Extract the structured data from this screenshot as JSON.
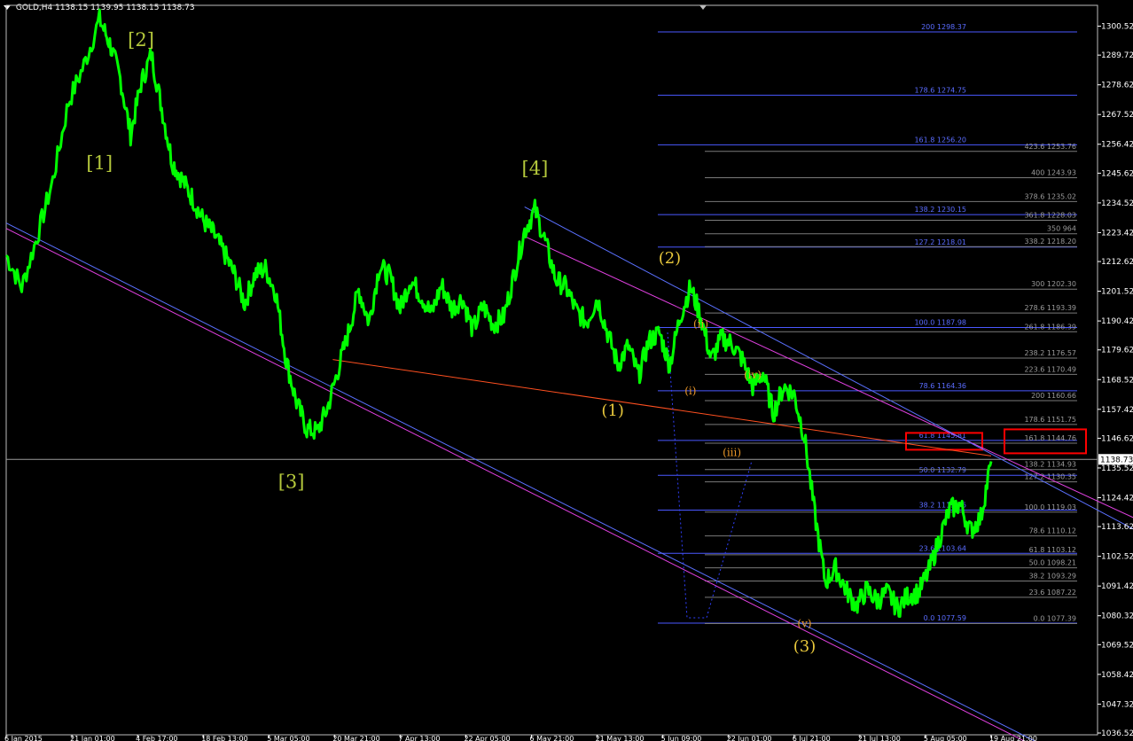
{
  "header": {
    "symbol": "GOLD,H4",
    "ohlc": "1138.15 1139.95 1138.15 1138.73"
  },
  "colors": {
    "background": "#000000",
    "price": "#00ff00",
    "axis": "#ffffff",
    "wave_major": "#b4c83c",
    "wave_intermediate": "#e8c83c",
    "wave_minor": "#e89628",
    "fib_line": "#4a58ff",
    "fib_line_right": "#7a7a7a",
    "fib_text": "#5a6cff",
    "fib_text_right": "#9a9a9a",
    "channel_magenta": "#e040e0",
    "channel_blue": "#5a70ff",
    "trend_orange": "#ff5020",
    "highlight_box": "#ff0000"
  },
  "chart_data": {
    "type": "line",
    "series_name": "GOLD,H4",
    "ylim": [
      1036.52,
      1305.0
    ],
    "y_ticks": [
      "1300.52",
      "1289.72",
      "1278.62",
      "1267.52",
      "1256.42",
      "1245.62",
      "1234.52",
      "1223.42",
      "1212.62",
      "1201.52",
      "1190.42",
      "1179.62",
      "1168.52",
      "1157.42",
      "1146.62",
      "1135.52",
      "1124.42",
      "1113.62",
      "1102.52",
      "1091.42",
      "1080.32",
      "1069.52",
      "1058.42",
      "1047.32",
      "1036.52"
    ],
    "current_price": "1138.73",
    "x_ticks": [
      "6 Jan 2015",
      "21 Jan 01:00",
      "4 Feb 17:00",
      "18 Feb 13:00",
      "5 Mar 05:00",
      "20 Mar 21:00",
      "7 Apr 13:00",
      "22 Apr 05:00",
      "6 May 21:00",
      "21 May 13:00",
      "5 Jun 09:00",
      "22 Jun 01:00",
      "6 Jul 21:00",
      "21 Jul 13:00",
      "5 Aug 05:00",
      "19 Aug 21:00"
    ],
    "price_points": [
      [
        0,
        1215
      ],
      [
        3,
        1203
      ],
      [
        6,
        1222
      ],
      [
        9,
        1243
      ],
      [
        12,
        1272
      ],
      [
        15,
        1286
      ],
      [
        18,
        1303
      ],
      [
        20,
        1294
      ],
      [
        22,
        1281
      ],
      [
        24,
        1260
      ],
      [
        26,
        1279
      ],
      [
        28,
        1290
      ],
      [
        30,
        1270
      ],
      [
        32,
        1250
      ],
      [
        34,
        1243
      ],
      [
        36,
        1236
      ],
      [
        38,
        1228
      ],
      [
        40,
        1223
      ],
      [
        42,
        1216
      ],
      [
        44,
        1208
      ],
      [
        46,
        1197
      ],
      [
        48,
        1208
      ],
      [
        50,
        1210
      ],
      [
        52,
        1201
      ],
      [
        54,
        1176
      ],
      [
        56,
        1160
      ],
      [
        58,
        1150
      ],
      [
        60,
        1149
      ],
      [
        62,
        1158
      ],
      [
        64,
        1172
      ],
      [
        66,
        1186
      ],
      [
        68,
        1202
      ],
      [
        70,
        1190
      ],
      [
        72,
        1211
      ],
      [
        74,
        1207
      ],
      [
        76,
        1195
      ],
      [
        78,
        1206
      ],
      [
        80,
        1200
      ],
      [
        82,
        1193
      ],
      [
        84,
        1204
      ],
      [
        86,
        1195
      ],
      [
        88,
        1199
      ],
      [
        90,
        1187
      ],
      [
        92,
        1196
      ],
      [
        94,
        1189
      ],
      [
        96,
        1192
      ],
      [
        98,
        1208
      ],
      [
        100,
        1224
      ],
      [
        102,
        1232
      ],
      [
        104,
        1220
      ],
      [
        106,
        1206
      ],
      [
        108,
        1203
      ],
      [
        110,
        1194
      ],
      [
        112,
        1190
      ],
      [
        114,
        1199
      ],
      [
        116,
        1186
      ],
      [
        118,
        1174
      ],
      [
        120,
        1181
      ],
      [
        122,
        1170
      ],
      [
        124,
        1183
      ],
      [
        126,
        1186
      ],
      [
        128,
        1174
      ],
      [
        130,
        1192
      ],
      [
        132,
        1203
      ],
      [
        134,
        1192
      ],
      [
        136,
        1176
      ],
      [
        138,
        1184
      ],
      [
        140,
        1182
      ],
      [
        142,
        1176
      ],
      [
        144,
        1166
      ],
      [
        146,
        1171
      ],
      [
        148,
        1156
      ],
      [
        150,
        1166
      ],
      [
        152,
        1163
      ],
      [
        154,
        1147
      ],
      [
        156,
        1118
      ],
      [
        158,
        1093
      ],
      [
        160,
        1098
      ],
      [
        162,
        1090
      ],
      [
        164,
        1084
      ],
      [
        166,
        1090
      ],
      [
        168,
        1086
      ],
      [
        170,
        1089
      ],
      [
        172,
        1083
      ],
      [
        174,
        1088
      ],
      [
        176,
        1089
      ],
      [
        178,
        1097
      ],
      [
        180,
        1109
      ],
      [
        182,
        1120
      ],
      [
        184,
        1122
      ],
      [
        186,
        1112
      ],
      [
        188,
        1117
      ],
      [
        190,
        1138
      ]
    ],
    "wave_labels": [
      {
        "text": "[1]",
        "x": 18,
        "y": 1247,
        "level": "major"
      },
      {
        "text": "[2]",
        "x": 26,
        "y": 1293,
        "level": "major"
      },
      {
        "text": "[3]",
        "x": 55,
        "y": 1128,
        "level": "major"
      },
      {
        "text": "[4]",
        "x": 102,
        "y": 1245,
        "level": "major"
      },
      {
        "text": "(1)",
        "x": 117,
        "y": 1155,
        "level": "intermediate"
      },
      {
        "text": "(2)",
        "x": 128,
        "y": 1212,
        "level": "intermediate"
      },
      {
        "text": "(3)",
        "x": 154,
        "y": 1067,
        "level": "intermediate"
      },
      {
        "text": "(i)",
        "x": 132,
        "y": 1163,
        "level": "minor"
      },
      {
        "text": "(ii)",
        "x": 134,
        "y": 1188,
        "level": "minor"
      },
      {
        "text": "(iii)",
        "x": 140,
        "y": 1140,
        "level": "minor"
      },
      {
        "text": "(iv)",
        "x": 144,
        "y": 1169,
        "level": "minor"
      },
      {
        "text": "(v)",
        "x": 154,
        "y": 1076,
        "level": "minor"
      }
    ],
    "fib_left": [
      "200 1298.37",
      "178.6 1274.75",
      "161.8 1256.20",
      "138.2 1230.15",
      "127.2 1218.01",
      "100.0 1187.98",
      "78.6 1164.36",
      "61.8 1145.81",
      "50.0 1132.79",
      "38.2 1119.76",
      "23.6 1103.64",
      "0.0 1077.59"
    ],
    "fib_left_levels": [
      1298.37,
      1274.75,
      1256.2,
      1230.15,
      1218.01,
      1187.98,
      1164.36,
      1145.81,
      1132.79,
      1119.76,
      1103.64,
      1077.59
    ],
    "fib_right": [
      "423.6 1253.76",
      "400 1243.93",
      "378.6 1235.02",
      "361.8 1228.03",
      "350 964",
      "338.2 1218.20",
      "300 1202.30",
      "278.6 1193.39",
      "261.8 1186.39",
      "238.2 1176.57",
      "223.6 1170.49",
      "200 1160.66",
      "178.6 1151.75",
      "161.8 1144.76",
      "138.2 1134.93",
      "127.2 1130.35",
      "100.0 1119.03",
      "78.6 1110.12",
      "61.8 1103.12",
      "50.0 1098.21",
      "38.2 1093.29",
      "23.6 1087.22",
      "0.0 1077.39"
    ],
    "fib_right_levels": [
      1253.76,
      1243.93,
      1235.02,
      1228.03,
      1223.0,
      1218.2,
      1202.3,
      1193.39,
      1186.39,
      1176.57,
      1170.49,
      1160.66,
      1151.75,
      1144.76,
      1134.93,
      1130.35,
      1119.03,
      1110.12,
      1103.12,
      1098.21,
      1093.29,
      1087.22,
      1077.39
    ],
    "highlighted": [
      "61.8 1145.81",
      "161.8 1144.76"
    ],
    "trendlines": [
      {
        "color": "magenta",
        "p1": [
          0,
          1225
        ],
        "p2": [
          200,
          1030
        ]
      },
      {
        "color": "magenta",
        "p1": [
          100,
          1222
        ],
        "p2": [
          223,
          1112
        ]
      },
      {
        "color": "blue",
        "p1": [
          0,
          1227
        ],
        "p2": [
          200,
          1032
        ]
      },
      {
        "color": "blue",
        "p1": [
          100,
          1233
        ],
        "p2": [
          223,
          1107
        ]
      },
      {
        "color": "orange",
        "p1": [
          63,
          1176
        ],
        "p2": [
          190,
          1140
        ]
      }
    ]
  }
}
